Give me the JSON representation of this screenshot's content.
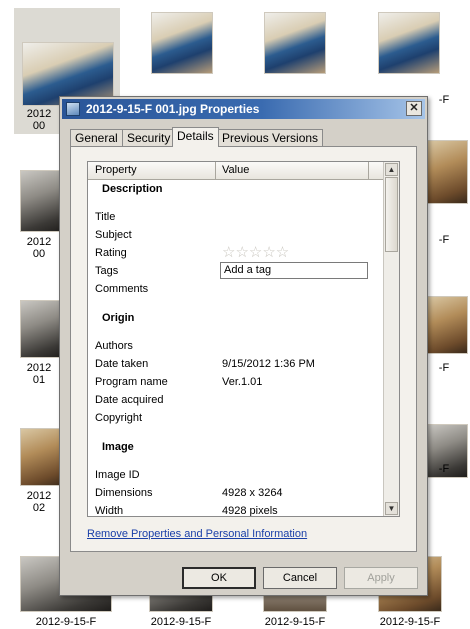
{
  "dialog": {
    "title": "2012-9-15-F 001.jpg Properties",
    "close_glyph": "✕",
    "tabs": [
      "General",
      "Security",
      "Details",
      "Previous Versions"
    ],
    "active_tab": "Details",
    "columns": {
      "property": "Property",
      "value": "Value"
    },
    "sections": {
      "description": {
        "heading": "Description",
        "rows": [
          {
            "label": "Title",
            "value": ""
          },
          {
            "label": "Subject",
            "value": ""
          },
          {
            "label": "Rating",
            "value": ""
          },
          {
            "label": "Tags",
            "value": "Add a tag"
          },
          {
            "label": "Comments",
            "value": ""
          }
        ]
      },
      "origin": {
        "heading": "Origin",
        "rows": [
          {
            "label": "Authors",
            "value": ""
          },
          {
            "label": "Date taken",
            "value": "9/15/2012 1:36 PM"
          },
          {
            "label": "Program name",
            "value": "Ver.1.01"
          },
          {
            "label": "Date acquired",
            "value": ""
          },
          {
            "label": "Copyright",
            "value": ""
          }
        ]
      },
      "image": {
        "heading": "Image",
        "rows": [
          {
            "label": "Image ID",
            "value": ""
          },
          {
            "label": "Dimensions",
            "value": "4928 x 3264"
          },
          {
            "label": "Width",
            "value": "4928 pixels"
          }
        ]
      }
    },
    "rating_stars": "☆☆☆☆☆",
    "remove_link": "Remove Properties and Personal Information",
    "buttons": {
      "ok": "OK",
      "cancel": "Cancel",
      "apply": "Apply"
    }
  },
  "background": {
    "thumb_caption": "2012-9-15-F",
    "left_partials": [
      "2012",
      "00",
      "2012",
      "00",
      "2012",
      "01",
      "2012",
      "02"
    ],
    "right_partials": [
      "-F",
      "-F",
      "-F",
      "-F"
    ]
  },
  "colors": {
    "title_bar": "#2a5598",
    "dialog_face": "#d4d0c8",
    "link": "#1a3fa8"
  }
}
